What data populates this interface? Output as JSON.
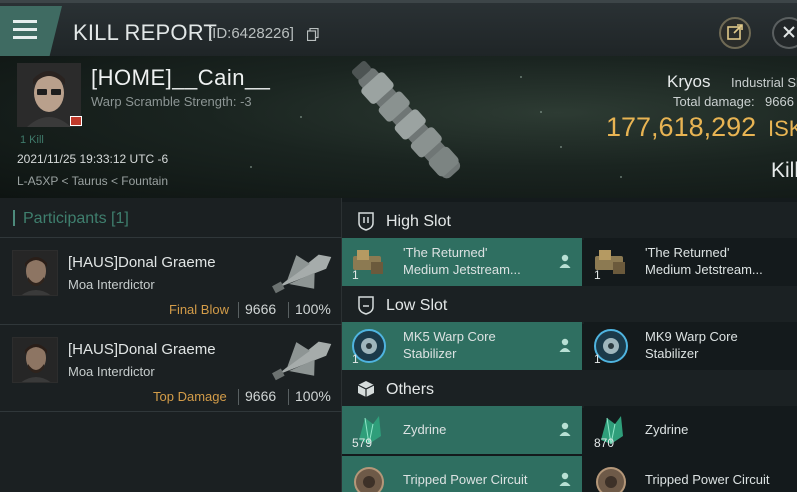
{
  "titlebar": {
    "title": "KILL REPORT",
    "kill_id": "[ID:6428226]",
    "icons": [
      "menu-icon",
      "copy-icon",
      "share-icon",
      "close-icon"
    ]
  },
  "victim": {
    "name": "[HOME]__Cain__",
    "warp_scramble": "Warp Scramble Strength: -3",
    "kill_tag": "1 Kill",
    "date": "2021/11/25 19:33:12 UTC -6",
    "location": "L-A5XP < Taurus < Fountain"
  },
  "ship": {
    "name": "Kryos",
    "class": "Industrial Ship",
    "total_damage_label": "Total damage:",
    "total_damage_value": "9666",
    "isk_value": "177,618,292",
    "isk_unit": "ISK",
    "status": "Kill"
  },
  "participants": {
    "header": "Participants [1]",
    "list": [
      {
        "name": "[HAUS]Donal Graeme",
        "ship": "Moa Interdictor",
        "tag": "Final Blow",
        "damage": "9666",
        "percent": "100%"
      },
      {
        "name": "[HAUS]Donal Graeme",
        "ship": "Moa Interdictor",
        "tag": "Top Damage",
        "damage": "9666",
        "percent": "100%"
      }
    ]
  },
  "slots": {
    "high": {
      "label": "High Slot",
      "items": [
        {
          "qty": "1",
          "name1": "'The Returned'",
          "name2": "Medium Jetstream...",
          "dropped": true
        },
        {
          "qty": "1",
          "name1": "'The Returned'",
          "name2": "Medium Jetstream...",
          "dropped": false
        }
      ]
    },
    "low": {
      "label": "Low Slot",
      "items": [
        {
          "qty": "1",
          "name1": "MK5 Warp Core",
          "name2": "Stabilizer",
          "dropped": true
        },
        {
          "qty": "1",
          "name1": "MK9 Warp Core",
          "name2": "Stabilizer",
          "dropped": false
        }
      ]
    },
    "others": {
      "label": "Others",
      "items": [
        {
          "qty": "579",
          "name1": "Zydrine",
          "dropped": true
        },
        {
          "qty": "870",
          "name1": "Zydrine",
          "dropped": false
        },
        {
          "qty": "",
          "name1": "Tripped Power Circuit",
          "dropped": true
        },
        {
          "qty": "",
          "name1": "Tripped Power Circuit",
          "dropped": false
        }
      ]
    }
  },
  "colors": {
    "accent": "#3f7f6e",
    "dropped_bg": "#2f6f61",
    "isk": "#e8b453",
    "tag": "#d39c49"
  }
}
